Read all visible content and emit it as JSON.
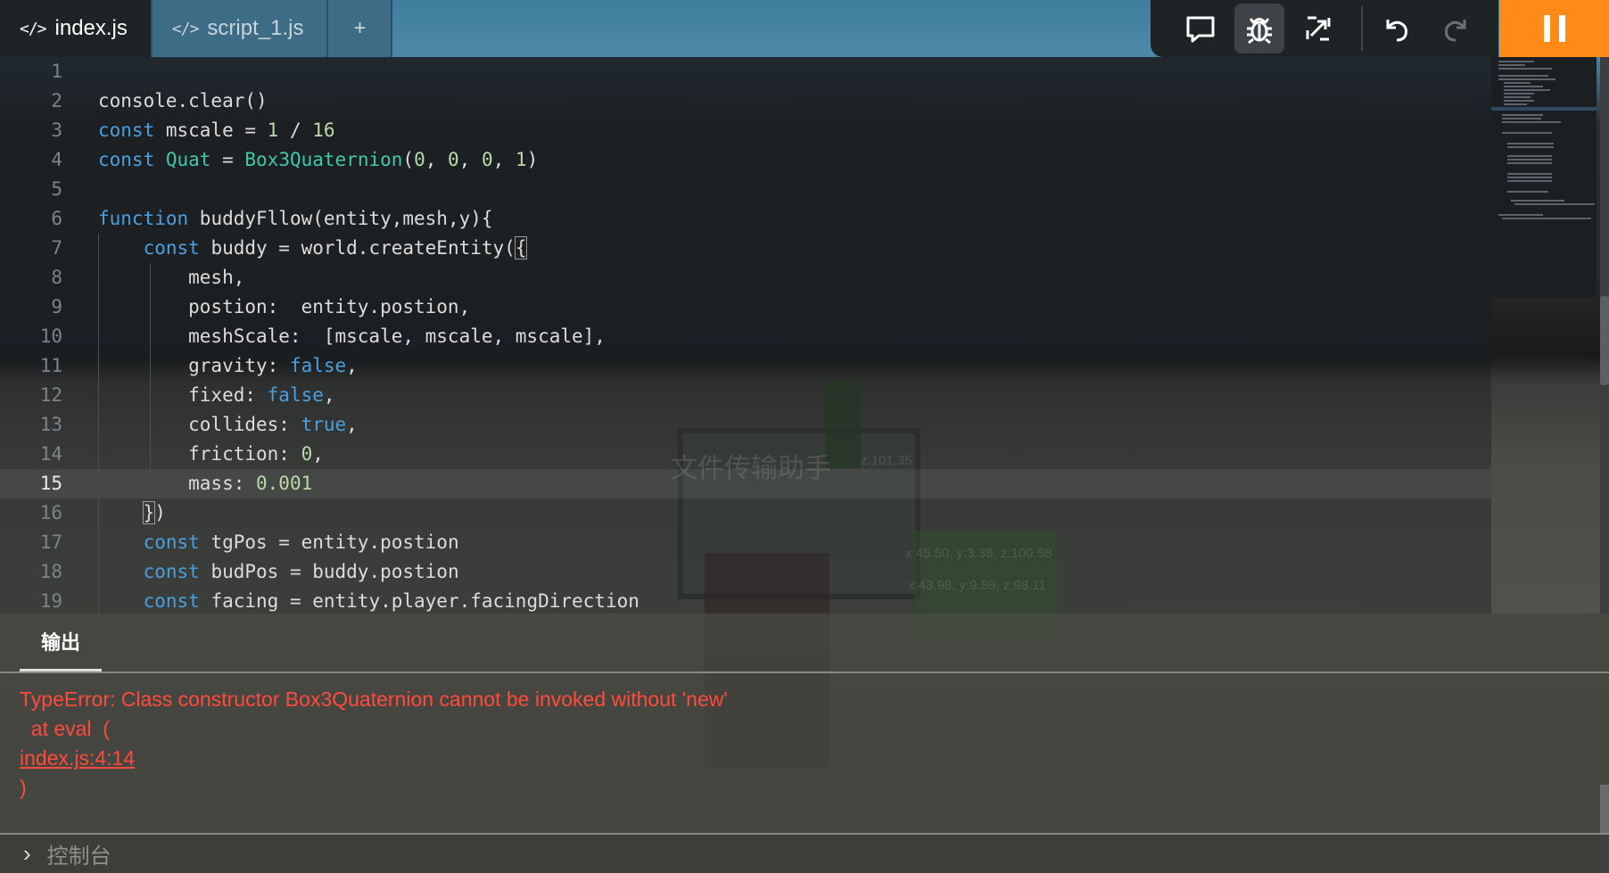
{
  "tabs": [
    {
      "icon": "code-icon",
      "label": "index.js",
      "active": true
    },
    {
      "icon": "code-icon",
      "label": "script_1.js",
      "active": false
    }
  ],
  "add_tab_label": "+",
  "toolbar": {
    "buttons": [
      "chat-icon",
      "bug-icon",
      "expand-icon",
      "undo-icon",
      "redo-icon"
    ],
    "pause_icon": "pause-icon",
    "accent": "#ff8a17"
  },
  "scene_labels": [
    "文件传输助手",
    "z:101.35",
    "x:45.50, y:3.38, z:100.58",
    "x:43.98, y:9.59, z:98.11"
  ],
  "editor": {
    "current_line": 15,
    "lines": [
      {
        "n": "1",
        "text": ""
      },
      {
        "n": "2",
        "text": "console.clear()"
      },
      {
        "n": "3",
        "text": "const mscale = 1 / 16"
      },
      {
        "n": "4",
        "text": "const Quat = Box3Quaternion(0, 0, 0, 1)"
      },
      {
        "n": "5",
        "text": ""
      },
      {
        "n": "6",
        "text": "function buddyFllow(entity,mesh,y){"
      },
      {
        "n": "7",
        "text": "    const buddy = world.createEntity({"
      },
      {
        "n": "8",
        "text": "        mesh,"
      },
      {
        "n": "9",
        "text": "        postion:  entity.postion,"
      },
      {
        "n": "10",
        "text": "        meshScale:  [mscale, mscale, mscale],"
      },
      {
        "n": "11",
        "text": "        gravity: false,"
      },
      {
        "n": "12",
        "text": "        fixed: false,"
      },
      {
        "n": "13",
        "text": "        collides: true,"
      },
      {
        "n": "14",
        "text": "        friction: 0,"
      },
      {
        "n": "15",
        "text": "        mass: 0.001"
      },
      {
        "n": "16",
        "text": "    })"
      },
      {
        "n": "17",
        "text": "    const tgPos = entity.postion"
      },
      {
        "n": "18",
        "text": "    const budPos = buddy.postion"
      },
      {
        "n": "19",
        "text": "    const facing = entity.player.facingDirection"
      }
    ]
  },
  "output": {
    "tab_label": "输出",
    "error_line1": "TypeError: Class constructor Box3Quaternion cannot be invoked without 'new'",
    "error_line2": "  at eval  (",
    "error_link": "index.js:4:14",
    "error_line4": ")",
    "error_color": "#ff4a3d"
  },
  "console": {
    "prompt_icon": "chevron-right-icon",
    "placeholder": "控制台"
  }
}
